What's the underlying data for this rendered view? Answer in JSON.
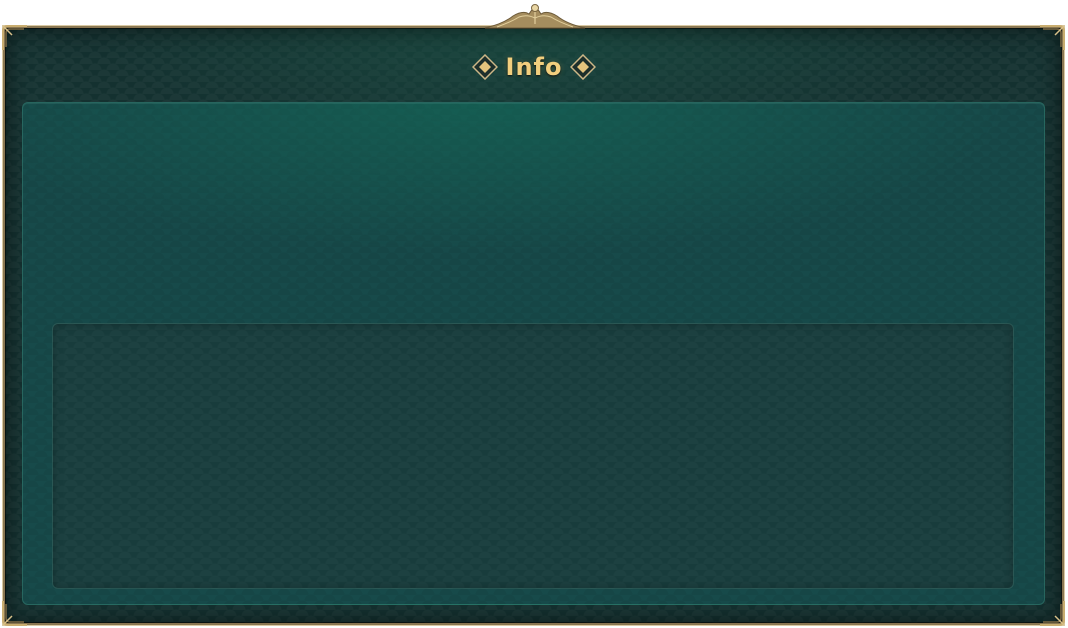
{
  "dialog": {
    "title": "Info"
  },
  "colors": {
    "frame_gold": "#8a7752",
    "title_gold": "#f2cf7e",
    "frame_dark": "#143130",
    "panel_teal": "#174a4a",
    "inner_panel": "#183c3c"
  },
  "icons": {
    "title_left": "diamond-ornament-icon",
    "title_right": "diamond-ornament-icon",
    "crest": "crest-ornament-icon",
    "corners": "corner-ornament-icon"
  }
}
